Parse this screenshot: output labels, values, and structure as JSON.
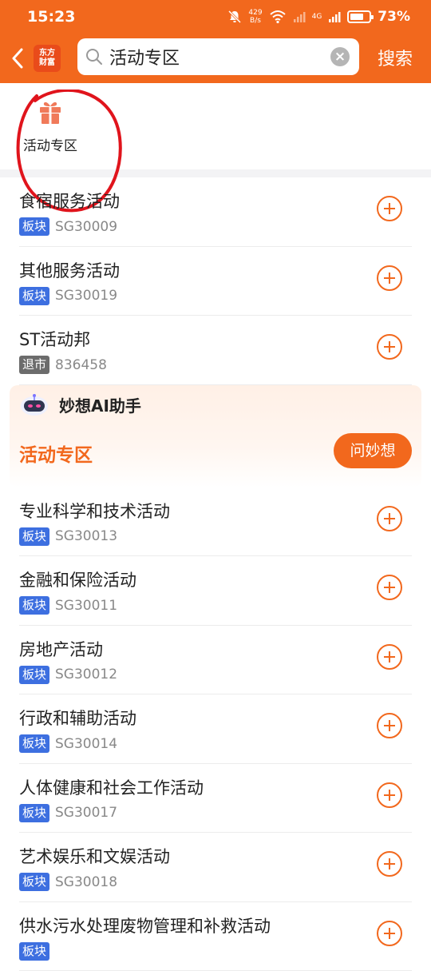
{
  "status_bar": {
    "time": "15:23",
    "net_speed_top": "429",
    "net_speed_bottom": "B/s",
    "signal_label": "4G",
    "battery": "73%",
    "battery_level": 0.73
  },
  "header": {
    "logo_line1": "东方",
    "logo_line2": "财富",
    "search_value": "活动专区",
    "search_button": "搜索"
  },
  "quick_entry": {
    "label": "活动专区"
  },
  "results_top": [
    {
      "name": "食宿服务活动",
      "tag": "板块",
      "code": "SG30009"
    },
    {
      "name": "其他服务活动",
      "tag": "板块",
      "code": "SG30019"
    },
    {
      "name": "ST活动邦",
      "tag": "退市",
      "code": "836458"
    }
  ],
  "ai_card": {
    "title": "妙想AI助手",
    "topic": "活动专区",
    "ask_button": "问妙想"
  },
  "results_bottom": [
    {
      "name": "专业科学和技术活动",
      "tag": "板块",
      "code": "SG30013"
    },
    {
      "name": "金融和保险活动",
      "tag": "板块",
      "code": "SG30011"
    },
    {
      "name": "房地产活动",
      "tag": "板块",
      "code": "SG30012"
    },
    {
      "name": "行政和辅助活动",
      "tag": "板块",
      "code": "SG30014"
    },
    {
      "name": "人体健康和社会工作活动",
      "tag": "板块",
      "code": "SG30017"
    },
    {
      "name": "艺术娱乐和文娱活动",
      "tag": "板块",
      "code": "SG30018"
    },
    {
      "name": "供水污水处理废物管理和补救活动",
      "tag": "板块",
      "code": ""
    }
  ],
  "colors": {
    "brand": "#f2681d",
    "tag_blue": "#3d6fe0",
    "tag_gray": "#6c6c6c",
    "annotation_red": "#e0141c"
  }
}
